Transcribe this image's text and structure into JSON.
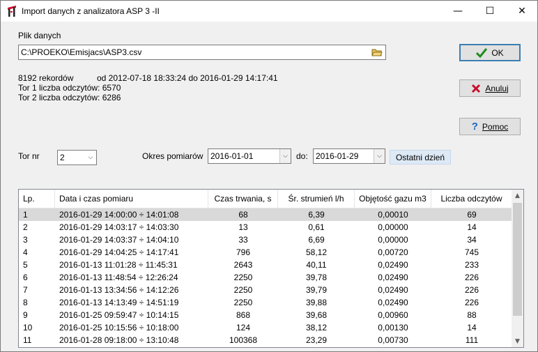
{
  "window": {
    "title": "Import danych z analizatora ASP 3 -II",
    "icon": "app-crane-icon",
    "controls": {
      "minimize": "—",
      "maximize": "☐",
      "close": "✕"
    }
  },
  "file": {
    "label": "Plik danych",
    "path": "C:\\PROEKO\\Emisjacs\\ASP3.csv",
    "browse_icon": "folder-open-icon"
  },
  "info": {
    "records": "8192 rekordów",
    "range": "od 2012-07-18 18:33:24   do 2016-01-29 14:17:41",
    "tor1": "Tor 1   liczba odczytów: 6570",
    "tor2": "Tor 2   liczba odczytów: 6286"
  },
  "buttons": {
    "ok": "OK",
    "cancel": "Anuluj",
    "help": "Pomoc",
    "last_day": "Ostatni dzień"
  },
  "filters": {
    "tor_label": "Tor nr",
    "tor_value": "2",
    "period_label": "Okres pomiarów",
    "from": "2016-01-01",
    "to_label": "do:",
    "to": "2016-01-29"
  },
  "table": {
    "columns": [
      "Lp.",
      "Data i czas pomiaru",
      "Czas trwania, s",
      "Śr. strumień l/h",
      "Objętość gazu m3",
      "Liczba odczytów"
    ],
    "rows": [
      [
        "1",
        "2016-01-29 14:00:00 ÷ 14:01:08",
        "68",
        "6,39",
        "0,00010",
        "69"
      ],
      [
        "2",
        "2016-01-29 14:03:17 ÷ 14:03:30",
        "13",
        "0,61",
        "0,00000",
        "14"
      ],
      [
        "3",
        "2016-01-29 14:03:37 ÷ 14:04:10",
        "33",
        "6,69",
        "0,00000",
        "34"
      ],
      [
        "4",
        "2016-01-29 14:04:25 ÷ 14:17:41",
        "796",
        "58,12",
        "0,00720",
        "745"
      ],
      [
        "5",
        "2016-01-13 11:01:28 ÷ 11:45:31",
        "2643",
        "40,11",
        "0,02490",
        "233"
      ],
      [
        "6",
        "2016-01-13 11:48:54 ÷ 12:26:24",
        "2250",
        "39,78",
        "0,02490",
        "226"
      ],
      [
        "7",
        "2016-01-13 13:34:56 ÷ 14:12:26",
        "2250",
        "39,79",
        "0,02490",
        "226"
      ],
      [
        "8",
        "2016-01-13 14:13:49 ÷ 14:51:19",
        "2250",
        "39,88",
        "0,02490",
        "226"
      ],
      [
        "9",
        "2016-01-25 09:59:47 ÷ 10:14:15",
        "868",
        "39,68",
        "0,00960",
        "88"
      ],
      [
        "10",
        "2016-01-25 10:15:56 ÷ 10:18:00",
        "124",
        "38,12",
        "0,00130",
        "14"
      ],
      [
        "11",
        "2016-01-28 09:18:00 ÷ 13:10:48",
        "100368",
        "23,29",
        "0,00730",
        "111"
      ]
    ],
    "selected_row": 0
  }
}
